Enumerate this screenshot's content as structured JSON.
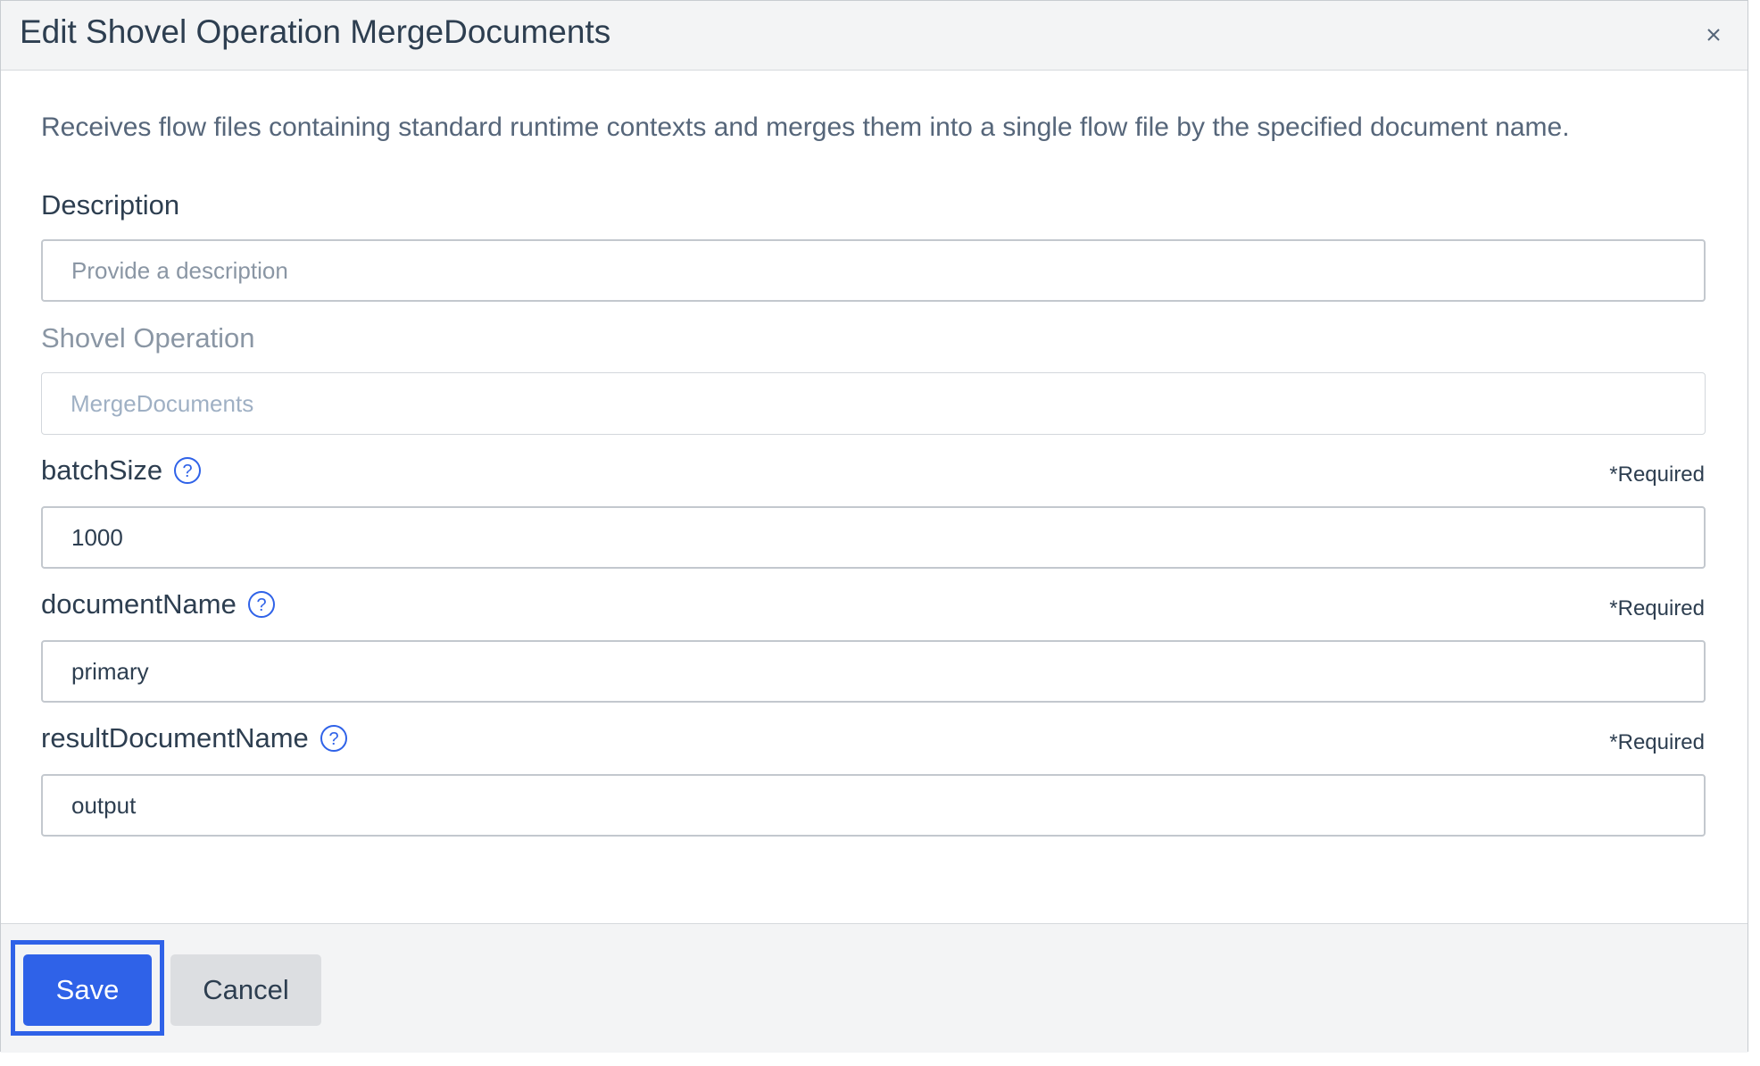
{
  "dialog": {
    "title": "Edit Shovel Operation MergeDocuments",
    "close_icon": "close-icon"
  },
  "intro": "Receives flow files containing standard runtime contexts and merges them into a single flow file by the specified document name.",
  "fields": {
    "description": {
      "label": "Description",
      "placeholder": "Provide a description",
      "value": ""
    },
    "shovel_operation": {
      "label": "Shovel Operation",
      "value": "MergeDocuments",
      "disabled": true
    },
    "batch_size": {
      "label": "batchSize",
      "required": "*Required",
      "value": "1000",
      "help_icon": "help-circle-icon"
    },
    "document_name": {
      "label": "documentName",
      "required": "*Required",
      "value": "primary",
      "help_icon": "help-circle-icon"
    },
    "result_document_name": {
      "label": "resultDocumentName",
      "required": "*Required",
      "value": "output",
      "help_icon": "help-circle-icon"
    }
  },
  "footer": {
    "save_label": "Save",
    "cancel_label": "Cancel"
  },
  "colors": {
    "accent": "#2f62e8",
    "text": "#2d3e50",
    "muted": "#8a96a4",
    "header_bg": "#f3f4f5"
  }
}
